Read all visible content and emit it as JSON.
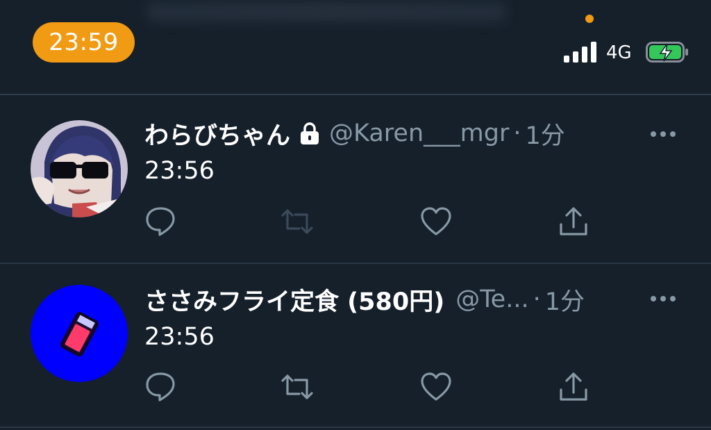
{
  "status_bar": {
    "time": "23:59",
    "network": "4G",
    "icons": [
      "orange-dot-indicator",
      "signal-bars-icon",
      "battery-charging-icon"
    ]
  },
  "tweets": [
    {
      "display_name": "わらびちゃん",
      "protected": true,
      "handle": "@Karen___mgr",
      "separator": "·",
      "age": "1分",
      "text": "23:56",
      "avatar_icon": "anime-girl-sunglasses-avatar",
      "retweet_enabled": false
    },
    {
      "display_name": "ささみフライ定食 (580円)",
      "protected": false,
      "handle": "@Te...",
      "separator": "·",
      "age": "1分",
      "text": "23:56",
      "avatar_icon": "blue-circle-red-eraser-avatar",
      "retweet_enabled": true
    }
  ],
  "colors": {
    "background": "#15202b",
    "time_pill": "#f19a13",
    "secondary_text": "#8899a6",
    "icon_gray": "#8899a6",
    "disabled_icon": "#3b4a5a",
    "battery_green": "#34c759"
  }
}
